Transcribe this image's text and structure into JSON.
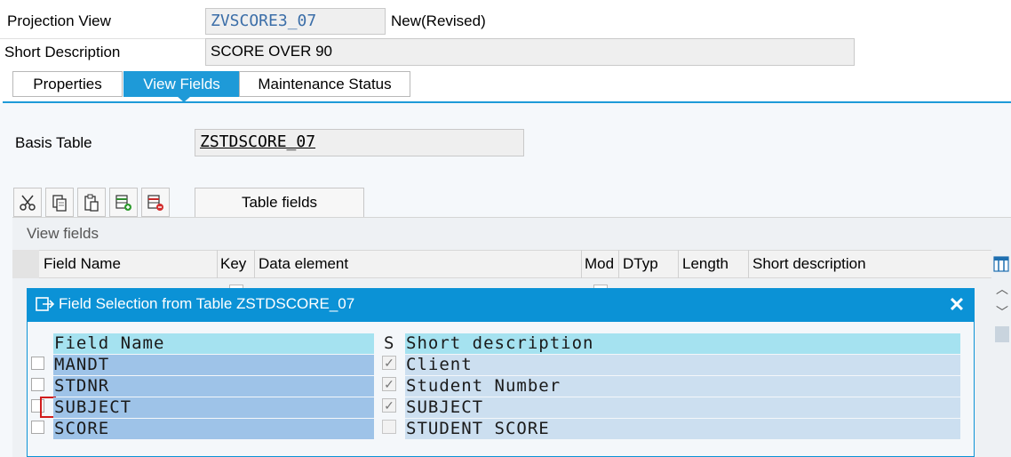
{
  "header": {
    "projection_view_label": "Projection View",
    "projection_view_value": "ZVSCORE3_07",
    "status": "New(Revised)",
    "short_desc_label": "Short Description",
    "short_desc_value": "SCORE OVER 90"
  },
  "tabs": [
    {
      "label": "Properties"
    },
    {
      "label": "View Fields"
    },
    {
      "label": "Maintenance Status"
    }
  ],
  "basis": {
    "label": "Basis Table",
    "value": "ZSTDSCORE_07"
  },
  "toolbar": {
    "table_fields_label": "Table fields"
  },
  "view_fields": {
    "section_title": "View fields",
    "columns": [
      "Field Name",
      "Key",
      "Data element",
      "Mod",
      "DTyp",
      "Length",
      "Short description"
    ]
  },
  "dialog": {
    "title": "Field Selection from Table ZSTDSCORE_07",
    "col_field_name": "Field Name",
    "col_s": "S",
    "col_short_desc": "Short description",
    "rows": [
      {
        "name": "MANDT",
        "desc": "Client",
        "s_checked": true,
        "selected": false
      },
      {
        "name": "STDNR",
        "desc": "Student Number",
        "s_checked": true,
        "selected": false
      },
      {
        "name": "SUBJECT",
        "desc": "SUBJECT",
        "s_checked": true,
        "selected": false
      },
      {
        "name": "SCORE",
        "desc": "STUDENT SCORE",
        "s_checked": false,
        "selected": false
      }
    ]
  },
  "colors": {
    "accent": "#0b92d6",
    "tab_active": "#1e9ad8",
    "row_name": "#9ec3e8",
    "row_desc": "#ccdff0",
    "header_row": "#a5e2f0"
  }
}
